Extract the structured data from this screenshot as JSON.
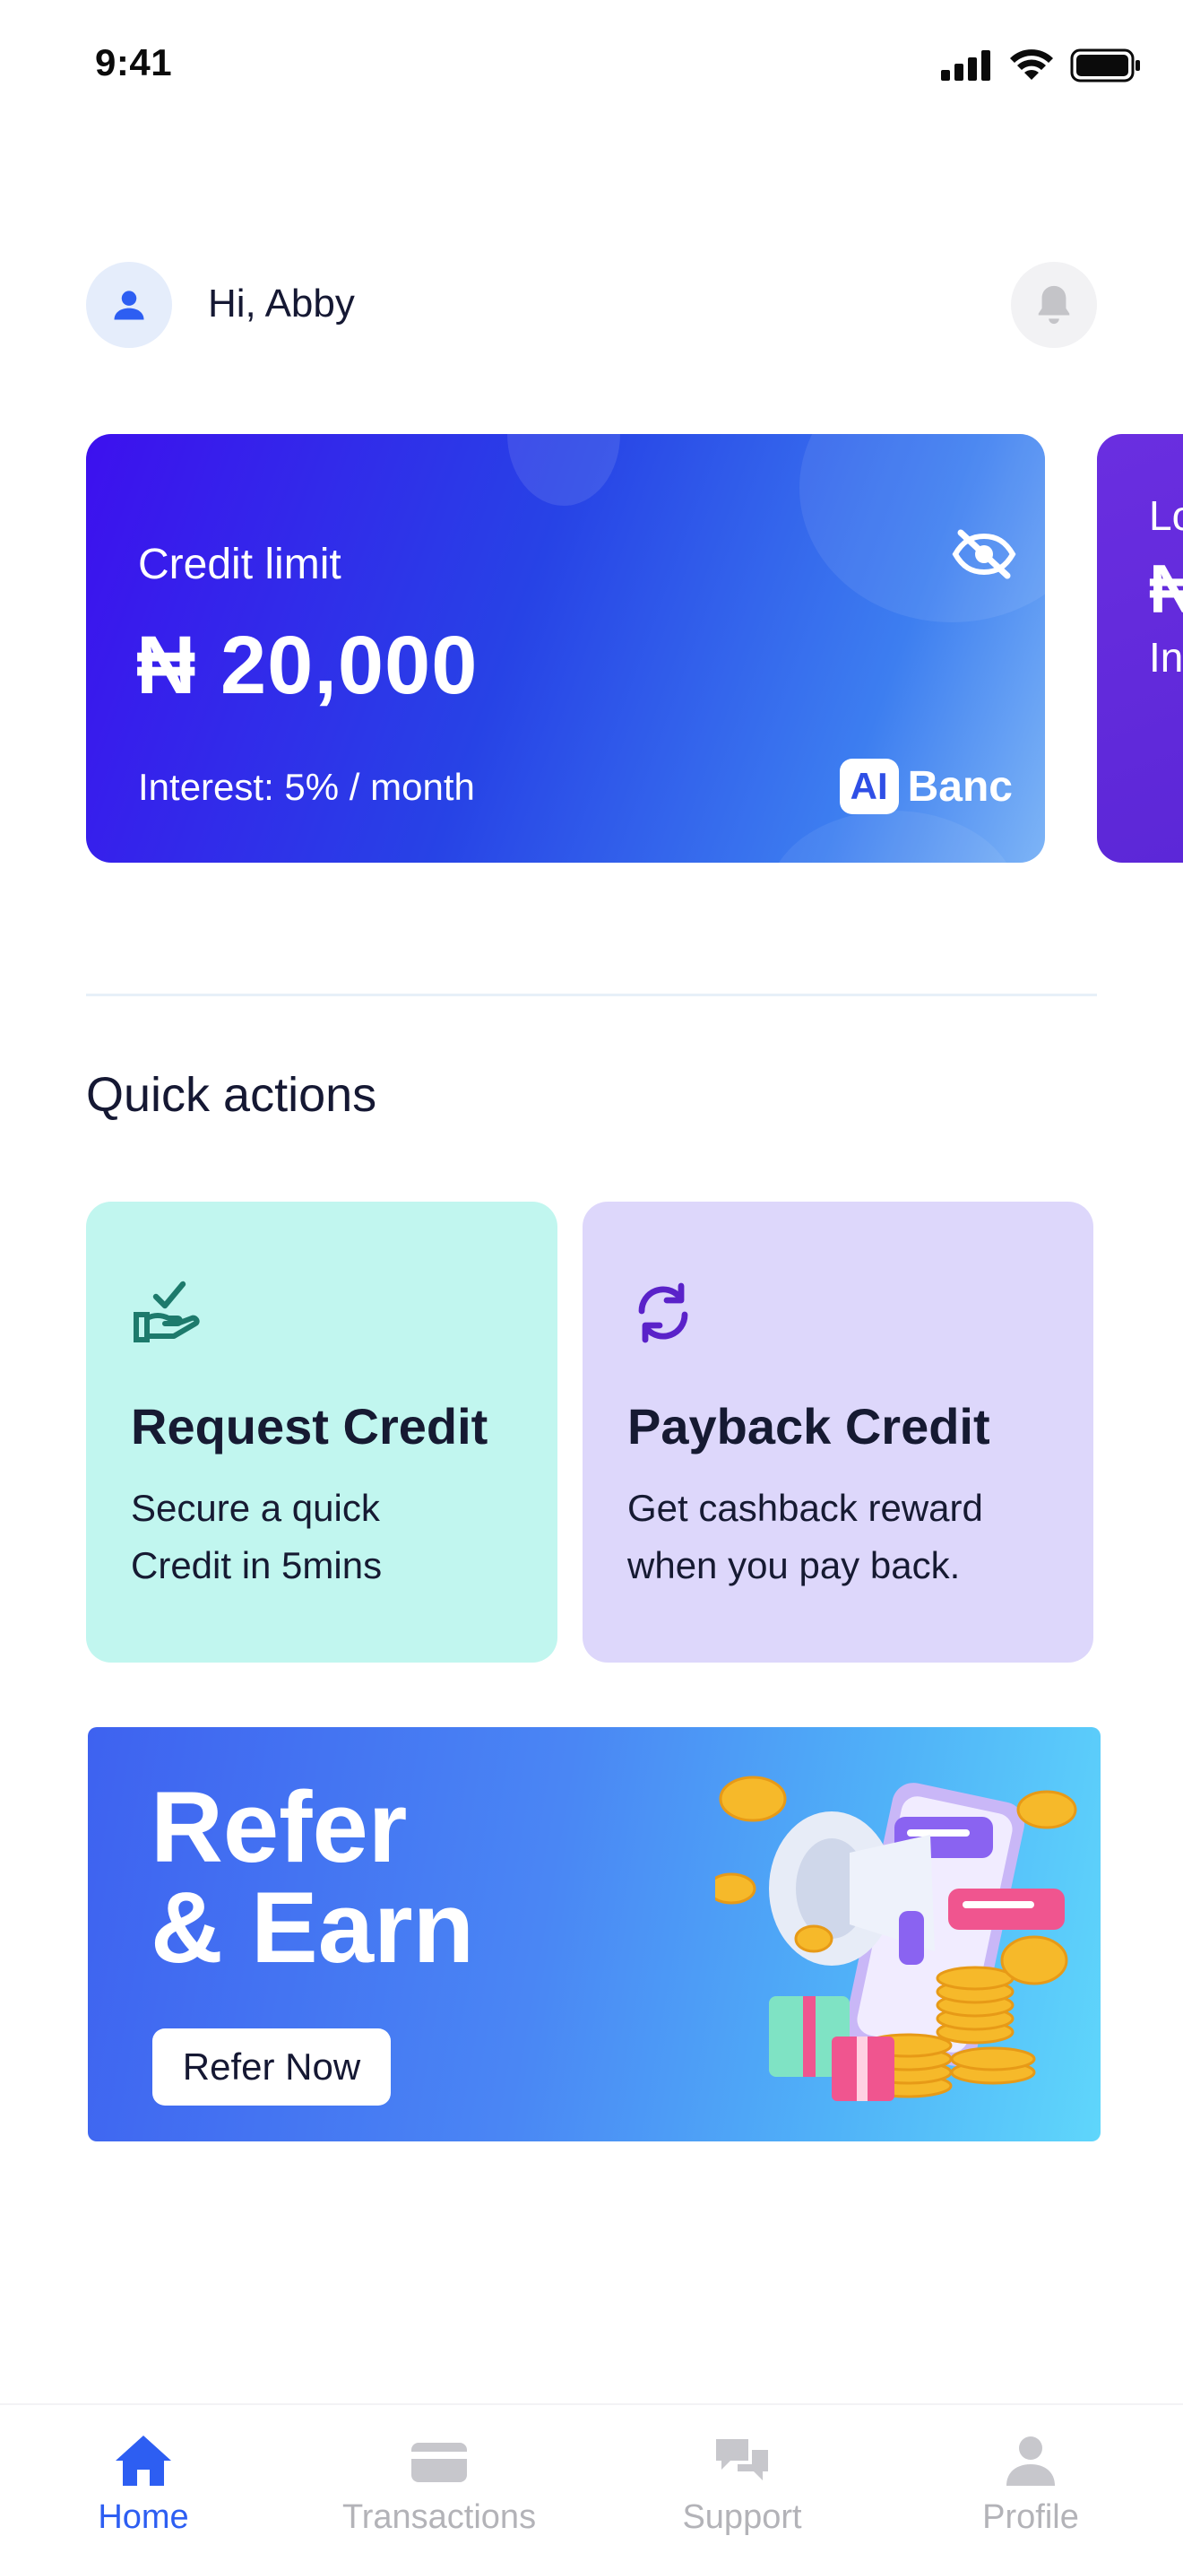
{
  "status_bar": {
    "time": "9:41",
    "icons": [
      "signal-icon",
      "wifi-icon",
      "battery-icon"
    ]
  },
  "header": {
    "greeting": "Hi, Abby",
    "avatar_icon": "user-icon",
    "notification_icon": "bell-icon"
  },
  "credit_card": {
    "label": "Credit limit",
    "amount": "₦ 20,000",
    "interest": "Interest: 5% / month",
    "brand_mark": "AI",
    "brand_name": "Banc",
    "visibility_icon": "eye-off-icon"
  },
  "loan_card_peek": {
    "line1": "Lo",
    "line2": "₦",
    "line3": "In"
  },
  "quick_actions": {
    "title": "Quick actions",
    "items": [
      {
        "title": "Request Credit",
        "desc": "Secure a quick Credit in 5mins",
        "icon": "hand-check-icon"
      },
      {
        "title": "Payback Credit",
        "desc": "Get cashback reward when you pay back.",
        "icon": "refresh-icon"
      }
    ]
  },
  "refer_banner": {
    "title": "Refer\n& Earn",
    "button_label": "Refer Now",
    "illustration": "megaphone-coins-illustration"
  },
  "bottom_nav": {
    "items": [
      {
        "label": "Home",
        "icon": "home-icon",
        "active": true
      },
      {
        "label": "Transactions",
        "icon": "card-icon",
        "active": false
      },
      {
        "label": "Support",
        "icon": "chat-icon",
        "active": false
      },
      {
        "label": "Profile",
        "icon": "profile-icon",
        "active": false
      }
    ]
  },
  "colors": {
    "primary": "#2d5ef2",
    "card_gradient_start": "#3d10ee",
    "request_tile": "#c1f6ef",
    "payback_tile": "#ddd7fb",
    "text_dark": "#151833"
  }
}
